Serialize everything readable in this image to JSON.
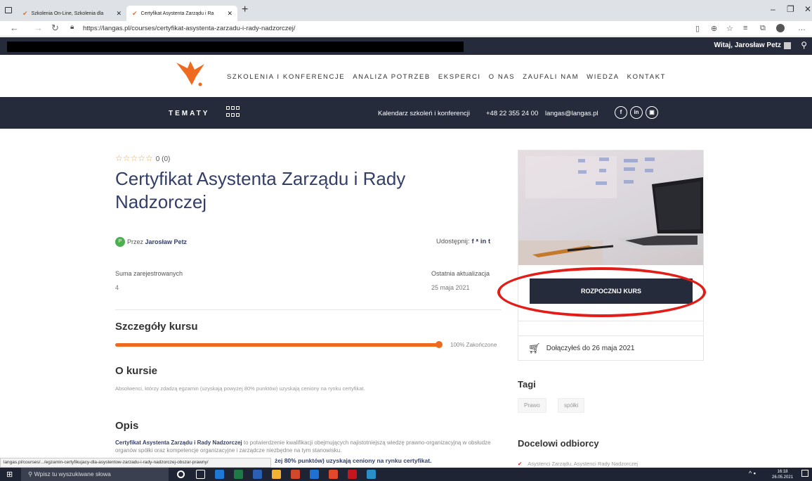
{
  "browser": {
    "tabs": [
      {
        "label": "Szkolenia On-Line, Szkolenia dla"
      },
      {
        "label": "Certyfikat Asystenta Zarządu i Ra"
      }
    ],
    "url": "https://langas.pl/courses/certyfikat-asystenta-zarzadu-i-rady-nadzorczej/"
  },
  "sitebar": {
    "greeting": "Witaj, Jarosław Petz"
  },
  "nav": {
    "items": [
      "SZKOLENIA I KONFERENCJE",
      "ANALIZA POTRZEB",
      "EKSPERCI",
      "O NAS",
      "ZAUFALI NAM",
      "WIEDZA",
      "KONTAKT"
    ]
  },
  "topicbar": {
    "tematy": "TEMATY",
    "calendar": "Kalendarz szkoleń i konferencji",
    "phone": "+48 22 355 24 00",
    "email": "langas@langas.pl",
    "social": [
      "f",
      "in",
      "▣"
    ]
  },
  "course": {
    "rating_stars": "☆☆☆☆☆",
    "rating_count": "0 (0)",
    "title": "Certyfikat Asystenta Zarządu i Rady Nadzorczej",
    "author_prefix": "Przez",
    "author": "Jarosław Petz",
    "author_initial": "P",
    "share_label": "Udostępnij:",
    "share_icons": "f  ᵜ  in  t",
    "enrolled_label": "Suma zarejestrowanych",
    "enrolled_value": "4",
    "updated_label": "Ostatnia aktualizacja",
    "updated_value": "25 maja 2021",
    "details_heading": "Szczegóły kursu",
    "progress_percent": 100,
    "progress_text": "100% Zakończone",
    "about_heading": "O kursie",
    "about_text": "Absolwenci, którzy zdadzą egzamin (uzyskają powyżej 80% punktów) uzyskają ceniony na rynku certyfikat.",
    "opis_heading": "Opis",
    "opis_bold": "Certyfikat Asystenta Zarządu i Rady Nadzorczej",
    "opis_text": " to potwierdzenie kwalifikacji obejmujących najistotniejszą wiedzę prawno-organizacyjną w obsłudze organów spółki oraz kompetencje organizacyjne i zarządcze niezbędne na tym stanowisku.",
    "opis_line2": "żej 80% punktów) uzyskają ceniony na rynku certyfikat."
  },
  "sidebar": {
    "start_button": "ROZPOCZNIJ KURS",
    "joined_text": "Dołączyłeś do 26 maja 2021",
    "tags_heading": "Tagi",
    "tags": [
      "Prawo",
      "spółki"
    ],
    "audience_heading": "Docelowi odbiorcy",
    "audience_item": "Asystenci Zarządu, Asystenci Rady Nadzorczej"
  },
  "status_url": "langas.pl/courses/.../egzamin-certyfikujacy-dla-asystentow-zarzadu-i-rady-nadzorczej-obszar-prawny/",
  "taskbar": {
    "search_placeholder": "Wpisz tu wyszukiwane słowa",
    "time": "16:18",
    "date": "26.05.2021"
  },
  "colors": {
    "accent": "#ee6a1f",
    "navy": "#252b3b",
    "title": "#333f66",
    "highlight": "#e41c17"
  }
}
